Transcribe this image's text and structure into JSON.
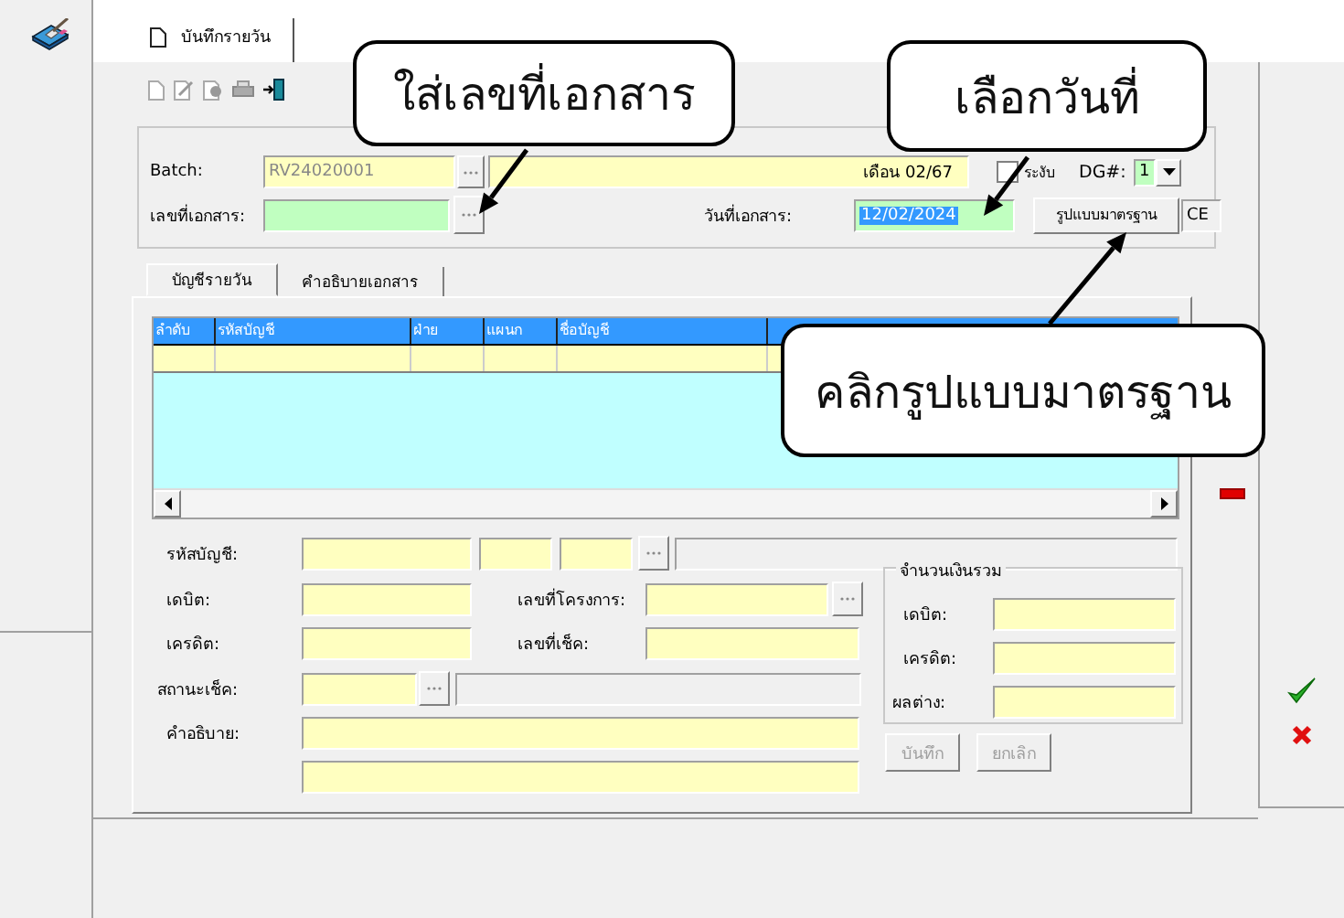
{
  "main_tab": {
    "label": "บันทึกรายวัน",
    "selected": true
  },
  "header": {
    "batch_label": "Batch:",
    "batch": "RV24020001",
    "batch_desc": "เดือน 02/67",
    "suspend_label": "ระงับ",
    "suspended": false,
    "dg_label": "DG#:",
    "dg": "1",
    "doc_no_label": "เลขที่เอกสาร:",
    "doc_date_label": "วันที่เอกสาร:",
    "doc_date": "12/02/2024",
    "template_button": "รูปแบบมาตรฐาน",
    "era": "CE"
  },
  "sub_tabs": [
    {
      "label": "บัญชีรายวัน",
      "selected": true
    },
    {
      "label": "คำอธิบายเอกสาร",
      "selected": false
    }
  ],
  "grid": {
    "columns": [
      {
        "label": "ลำดับ"
      },
      {
        "label": "รหัสบัญชี"
      },
      {
        "label": "ฝ่าย"
      },
      {
        "label": "แผนก"
      },
      {
        "label": "ชื่อบัญชี"
      }
    ]
  },
  "form": {
    "account_label": "รหัสบัญชี:",
    "debit_label": "เดบิต:",
    "credit_label": "เครดิต:",
    "cheque_status_label": "สถานะเช็ค:",
    "description_label": "คำอธิบาย:",
    "project_no_label": "เลขที่โครงการ:",
    "cheque_no_label": "เลขที่เช็ค:"
  },
  "totals": {
    "title": "จำนวนเงินรวม",
    "labels": [
      "เดบิต:",
      "เครดิต:",
      "ผลต่าง:"
    ]
  },
  "buttons": [
    {
      "label": "บันทึก",
      "disabled": true
    },
    {
      "label": "ยกเลิก",
      "disabled": true
    }
  ],
  "callouts": [
    {
      "text": "ใส่เลขที่เอกสาร"
    },
    {
      "text": "เลือกวันที่"
    },
    {
      "text": "คลิกรูปแบบมาตรฐาน"
    }
  ]
}
